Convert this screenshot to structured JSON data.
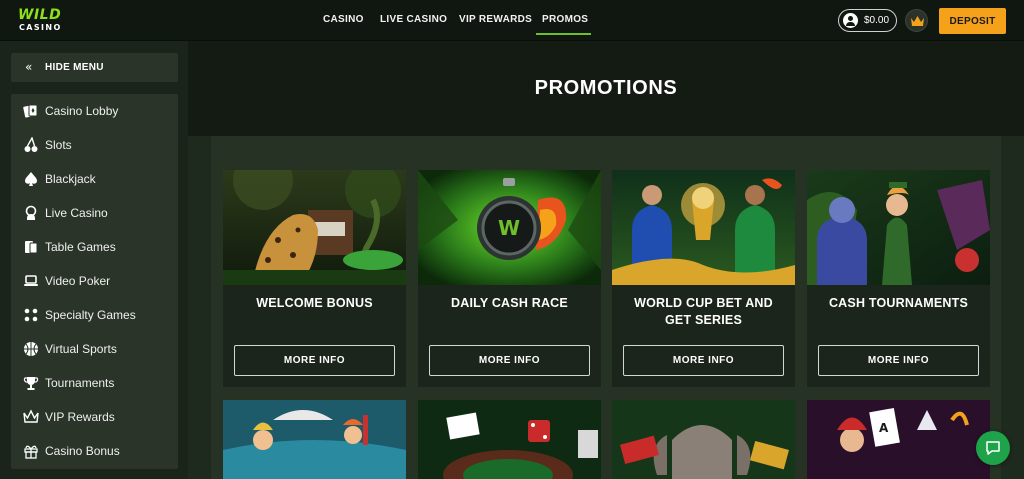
{
  "brand": {
    "logo_top": "WILD",
    "logo_bottom": "CASINO"
  },
  "nav": [
    {
      "label": "CASINO"
    },
    {
      "label": "LIVE CASINO"
    },
    {
      "label": "VIP REWARDS"
    },
    {
      "label": "PROMOS",
      "active": true
    }
  ],
  "header": {
    "balance": "$0.00",
    "deposit_label": "DEPOSIT"
  },
  "sidebar": {
    "hide_menu_label": "HIDE MENU",
    "items": [
      {
        "label": "Casino Lobby",
        "icon": "cards-icon"
      },
      {
        "label": "Slots",
        "icon": "cherries-icon"
      },
      {
        "label": "Blackjack",
        "icon": "spade-icon"
      },
      {
        "label": "Live Casino",
        "icon": "dealer-icon"
      },
      {
        "label": "Table Games",
        "icon": "table-cards-icon"
      },
      {
        "label": "Video Poker",
        "icon": "laptop-icon"
      },
      {
        "label": "Specialty Games",
        "icon": "dice-icon"
      },
      {
        "label": "Virtual Sports",
        "icon": "basketball-icon"
      },
      {
        "label": "Tournaments",
        "icon": "trophy-icon"
      },
      {
        "label": "VIP Rewards",
        "icon": "crown-icon"
      },
      {
        "label": "Casino Bonus",
        "icon": "gift-icon"
      }
    ]
  },
  "main": {
    "title": "PROMOTIONS",
    "promos": [
      {
        "title": "WELCOME BONUS",
        "button": "MORE INFO"
      },
      {
        "title": "DAILY CASH RACE",
        "button": "MORE INFO"
      },
      {
        "title": "WORLD CUP BET AND GET SERIES",
        "button": "MORE INFO"
      },
      {
        "title": "CASH TOURNAMENTS",
        "button": "MORE INFO"
      }
    ]
  },
  "colors": {
    "accent": "#6fbf2a",
    "deposit": "#f6a11a",
    "chat": "#1fa34a"
  }
}
